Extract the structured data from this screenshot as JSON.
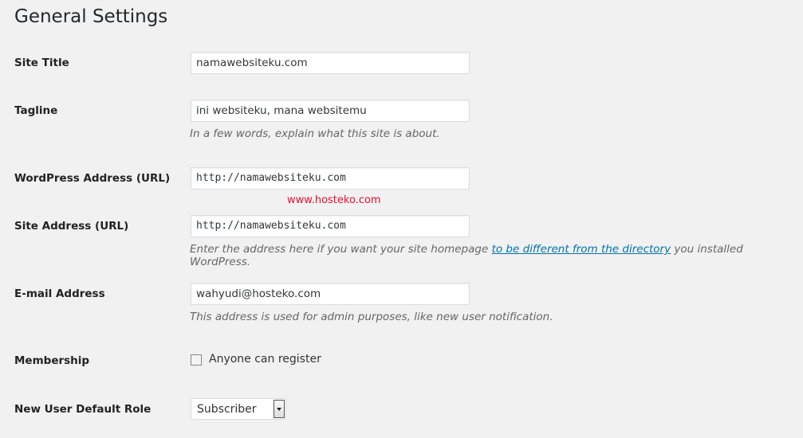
{
  "page_title": "General Settings",
  "watermark": "www.hosteko.com",
  "fields": {
    "site_title": {
      "label": "Site Title",
      "value": "namawebsiteku.com"
    },
    "tagline": {
      "label": "Tagline",
      "value": "ini websiteku, mana websitemu",
      "description": "In a few words, explain what this site is about."
    },
    "wp_address": {
      "label": "WordPress Address (URL)",
      "value": "http://namawebsiteku.com"
    },
    "site_address": {
      "label": "Site Address (URL)",
      "value": "http://namawebsiteku.com",
      "desc_before": "Enter the address here if you want your site homepage ",
      "desc_link": "to be different from the directory",
      "desc_after": " you installed WordPress."
    },
    "email": {
      "label": "E-mail Address",
      "value": "wahyudi@hosteko.com",
      "description": "This address is used for admin purposes, like new user notification."
    },
    "membership": {
      "label": "Membership",
      "checkbox_label": "Anyone can register",
      "checked": false
    },
    "default_role": {
      "label": "New User Default Role",
      "selected": "Subscriber"
    }
  }
}
